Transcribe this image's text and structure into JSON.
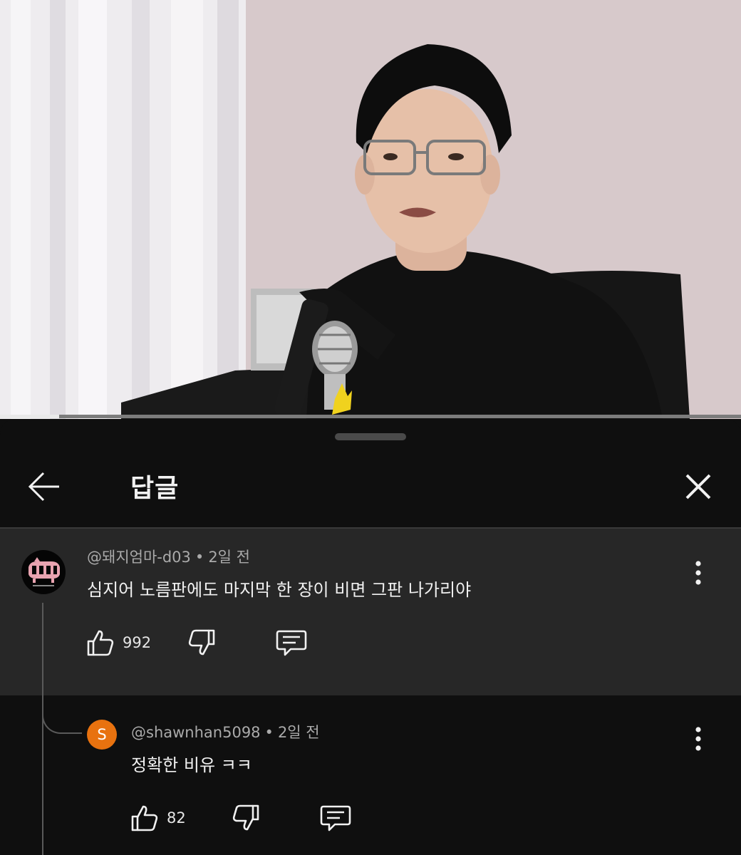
{
  "video": {
    "progress": 0.08
  },
  "sheet": {
    "title": "답글",
    "back_icon": "arrow-left-icon",
    "close_icon": "close-icon"
  },
  "comments": [
    {
      "author": "@돼지엄마-d03",
      "separator": "•",
      "time": "2일 전",
      "text": "심지어 노름판에도 마지막 한 장이 비면 그판 나가리야",
      "likes": "992",
      "avatar": "pig-logo"
    },
    {
      "author": "@shawnhan5098",
      "separator": "•",
      "time": "2일 전",
      "text": "정확한 비유 ㅋㅋ",
      "likes": "82",
      "avatar_letter": "S",
      "avatar_color": "#e8720f"
    }
  ]
}
